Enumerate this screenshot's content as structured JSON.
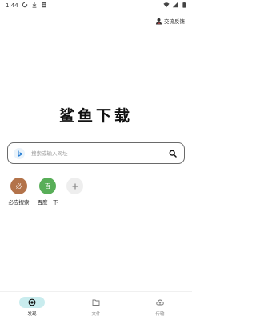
{
  "status_bar": {
    "time": "1:44",
    "left_icons": [
      "sync-icon",
      "download-icon",
      "notification-icon"
    ],
    "right_icons": [
      "wifi-icon",
      "signal-icon",
      "battery-icon"
    ]
  },
  "header": {
    "feedback_label": "交流反馈",
    "feedback_icon": "person-icon"
  },
  "logo": {
    "text": "鲨鱼下载"
  },
  "search": {
    "placeholder": "搜索或输入网址",
    "engine_icon": "bing-icon",
    "button_icon": "search-icon"
  },
  "shortcuts": [
    {
      "icon_text": "必",
      "label": "必应搜索",
      "color": "#b3734a"
    },
    {
      "icon_text": "百",
      "label": "百度一下",
      "color": "#58ae58"
    }
  ],
  "bottom_nav": [
    {
      "label": "发现",
      "icon": "discover-icon",
      "active": true
    },
    {
      "label": "文件",
      "icon": "folder-icon",
      "active": false
    },
    {
      "label": "传输",
      "icon": "cloud-upload-icon",
      "active": false
    }
  ],
  "colors": {
    "nav_active_bg": "#c9ecee",
    "search_border": "#6a6a6a",
    "bing_blue": "#2a7fd4"
  }
}
